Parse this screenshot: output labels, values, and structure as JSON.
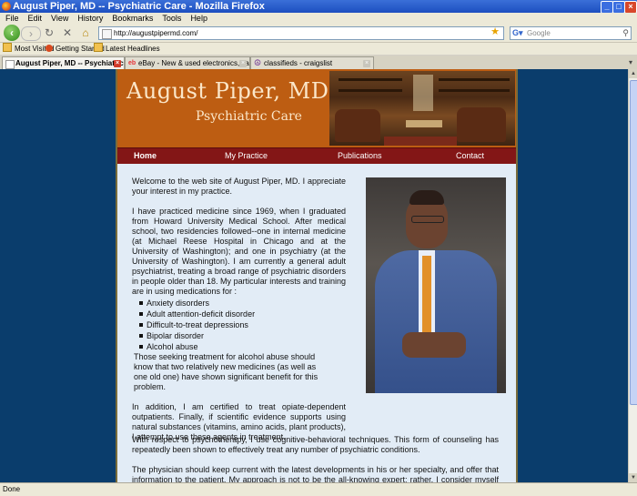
{
  "window": {
    "title": "August Piper, MD -- Psychiatric Care - Mozilla Firefox"
  },
  "menubar": [
    "File",
    "Edit",
    "View",
    "History",
    "Bookmarks",
    "Tools",
    "Help"
  ],
  "toolbar": {
    "url": "http://augustpipermd.com/",
    "search_placeholder": "Google"
  },
  "bookmarks": [
    "Most Visited",
    "Getting Started",
    "Latest Headlines"
  ],
  "tabs": [
    {
      "label": "August Piper, MD -- Psychiatric C..."
    },
    {
      "label": "eBay - New & used electronics, cars, a..."
    },
    {
      "label": "classifieds - craigslist"
    }
  ],
  "site": {
    "logo_name": "August Piper, MD",
    "logo_tagline": "Psychiatric Care",
    "nav": [
      "Home",
      "My Practice",
      "Publications",
      "Contact"
    ],
    "intro": "Welcome to the web site of August Piper, MD. I appreciate your interest in my practice.",
    "para1": "I have practiced medicine since 1969, when I graduated from Howard University Medical School. After medical school, two residencies followed--one in internal medicine (at Michael Reese Hospital in Chicago and at the University of Washington); and one in psychiatry (at the University of Washington). I am currently a general adult psychiatrist, treating a broad range of psychiatric disorders in people older than 18. My particular interests and training are in using medications for :",
    "conditions": [
      "Anxiety disorders",
      "Adult attention-deficit disorder",
      "Difficult-to-treat depressions",
      "Bipolar disorder",
      "Alcohol abuse"
    ],
    "alcohol_note": "Those seeking treatment for alcohol abuse should know that two relatively new medicines (as well as one old one) have shown significant benefit for this problem.",
    "para2": "In addition, I am certified to treat opiate-dependent outpatients. Finally, if scientific evidence supports using natural substances (vitamins, amino acids, plant products), I attempt to use these agents in treatment.",
    "para3": "With respect to psychotherapy, I use cognitive-behavioral techniques. This form of counseling has repeatedly been shown to effectively treat any number of psychiatric conditions.",
    "para4": "The physician should keep current with the latest developments in his or her specialty, and offer that information to the patient. My approach is not to be the all-knowing expert; rather, I consider myself an"
  },
  "status": "Done",
  "colors": {
    "header": "#bd5d12",
    "nav": "#831616",
    "page_bg": "#e2ecf6",
    "outer_bg": "#0a3d6c"
  }
}
